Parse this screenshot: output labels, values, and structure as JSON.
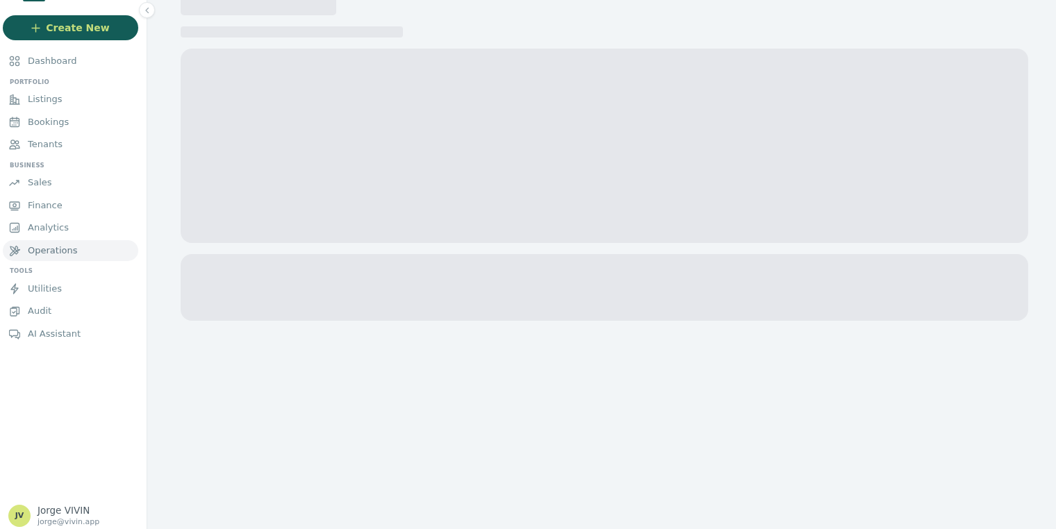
{
  "sidebar": {
    "create_button": {
      "label": "Create New"
    },
    "nav_groups": [
      {
        "items": [
          {
            "label": "Dashboard",
            "selected": false
          }
        ]
      },
      {
        "heading": "PORTFOLIO",
        "items": [
          {
            "label": "Listings",
            "selected": false
          },
          {
            "label": "Bookings",
            "selected": false
          },
          {
            "label": "Tenants",
            "selected": false
          }
        ]
      },
      {
        "heading": "BUSINESS",
        "items": [
          {
            "label": "Sales",
            "selected": false
          },
          {
            "label": "Finance",
            "selected": false
          },
          {
            "label": "Analytics",
            "selected": false
          },
          {
            "label": "Operations",
            "selected": true
          }
        ]
      },
      {
        "heading": "TOOLS",
        "items": [
          {
            "label": "Utilities",
            "selected": false
          },
          {
            "label": "Audit",
            "selected": false
          },
          {
            "label": "AI Assistant",
            "selected": false
          }
        ]
      }
    ],
    "user": {
      "initials": "JV",
      "name": "Jorge VIVIN",
      "email": "jorge@vivin.app"
    }
  },
  "main": {
    "loading_placeholders": [
      {
        "kind": "heading"
      },
      {
        "kind": "line"
      },
      {
        "kind": "panel"
      },
      {
        "kind": "strip"
      }
    ]
  }
}
